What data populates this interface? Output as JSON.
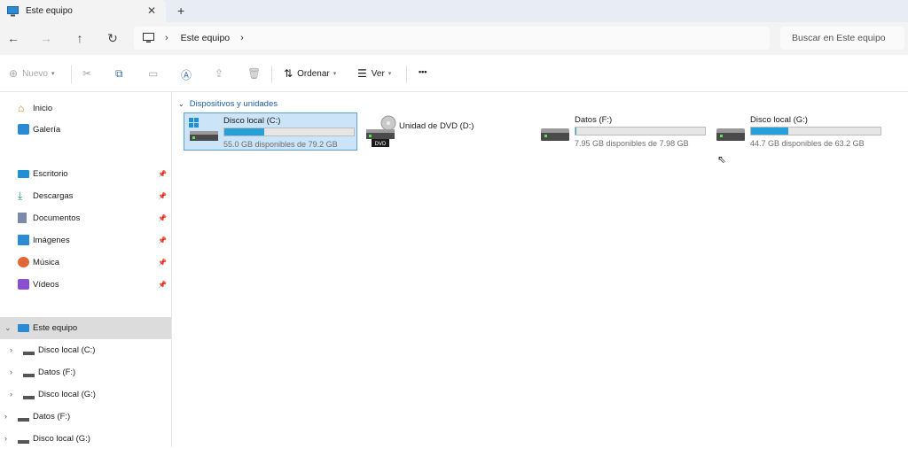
{
  "tab": {
    "title": "Este equipo",
    "close": "✕",
    "new": "+"
  },
  "nav": {
    "back": "←",
    "forward": "→",
    "up": "↑",
    "refresh": "↻"
  },
  "address": {
    "crumb": "Este equipo",
    "sep": "›"
  },
  "search": {
    "placeholder": "Buscar en Este equipo"
  },
  "toolbar": {
    "new_label": "Nuevo",
    "sort_label": "Ordenar",
    "view_label": "Ver",
    "more": "•••"
  },
  "sidebar": {
    "top": [
      {
        "label": "Inicio"
      },
      {
        "label": "Galería"
      }
    ],
    "pinned": [
      {
        "label": "Escritorio"
      },
      {
        "label": "Descargas"
      },
      {
        "label": "Documentos"
      },
      {
        "label": "Imágenes"
      },
      {
        "label": "Música"
      },
      {
        "label": "Vídeos"
      }
    ],
    "this_pc": "Este equipo",
    "pc_children": [
      {
        "label": "Disco local (C:)"
      },
      {
        "label": "Datos (F:)"
      },
      {
        "label": "Disco local (G:)"
      }
    ],
    "bottom": [
      {
        "label": "Datos (F:)"
      },
      {
        "label": "Disco local (G:)"
      }
    ]
  },
  "main": {
    "section": "Dispositivos y unidades",
    "drives": [
      {
        "name": "Disco local (C:)",
        "info": "55.0 GB disponibles de 79.2 GB",
        "used_fraction": 0.31,
        "selected": true
      },
      {
        "name": "Unidad de DVD (D:)",
        "badge": "DVD"
      },
      {
        "name": "Datos (F:)",
        "info": "7.95 GB disponibles de 7.98 GB",
        "used_fraction": 0.004
      },
      {
        "name": "Disco local (G:)",
        "info": "44.7 GB disponibles de 63.2 GB",
        "used_fraction": 0.29
      }
    ]
  },
  "colors": {
    "accent": "#26a0da",
    "selection": "#cce4f7",
    "section": "#1f5fa6"
  }
}
